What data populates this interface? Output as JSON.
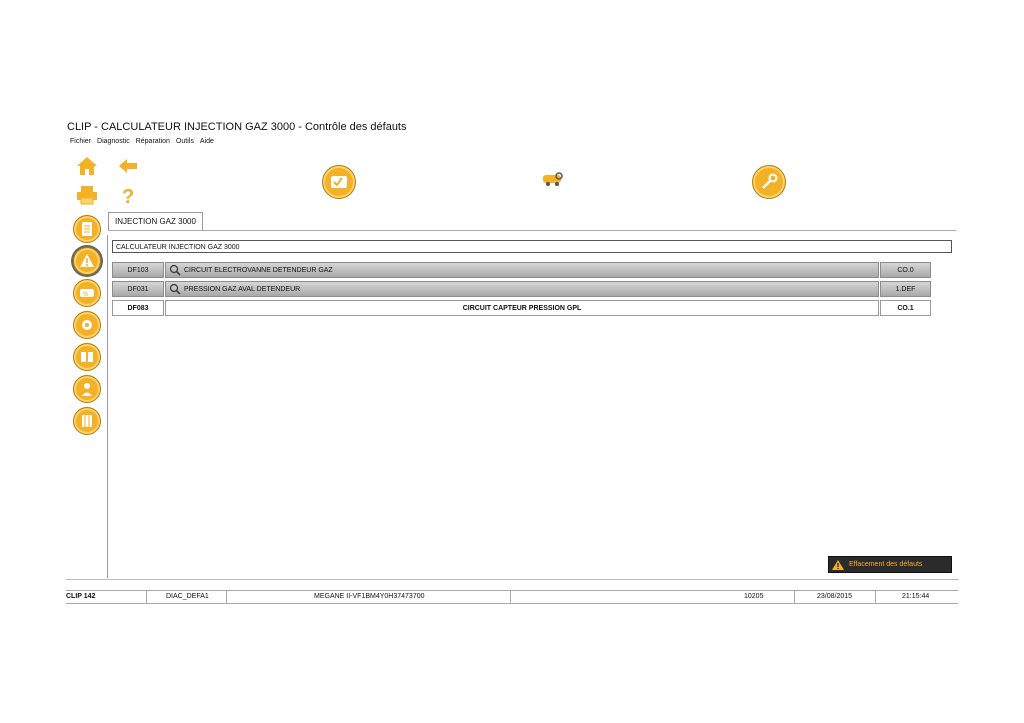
{
  "window": {
    "title": "CLIP - CALCULATEUR INJECTION GAZ 3000 - Contrôle des défauts"
  },
  "menu": [
    "Fichier",
    "Diagnostic",
    "Réparation",
    "Outils",
    "Aide"
  ],
  "tab": {
    "label": "INJECTION GAZ 3000"
  },
  "calculator": {
    "label": "CALCULATEUR INJECTION GAZ 3000"
  },
  "faults": [
    {
      "code": "DF103",
      "description": "CIRCUIT ELECTROVANNE DETENDEUR GAZ",
      "status": "CO.0"
    },
    {
      "code": "DF031",
      "description": "PRESSION GAZ AVAL DETENDEUR",
      "status": "1.DEF"
    },
    {
      "code": "DF083",
      "description": "CIRCUIT CAPTEUR PRESSION GPL",
      "status": "CO.1"
    }
  ],
  "actions": {
    "clear_faults": "Effacement des défauts"
  },
  "statusbar": {
    "clip": "CLIP 142",
    "diag": "DIAC_DEFA1",
    "vehicle": "MEGANE II-VF1BM4Y0H37473700",
    "code": "10205",
    "date": "23/08/2015",
    "time": "21:15:44"
  },
  "colors": {
    "accent": "#f3b128",
    "button_dark": "#2b2b2b",
    "row_grey": "#bdbdbd"
  }
}
